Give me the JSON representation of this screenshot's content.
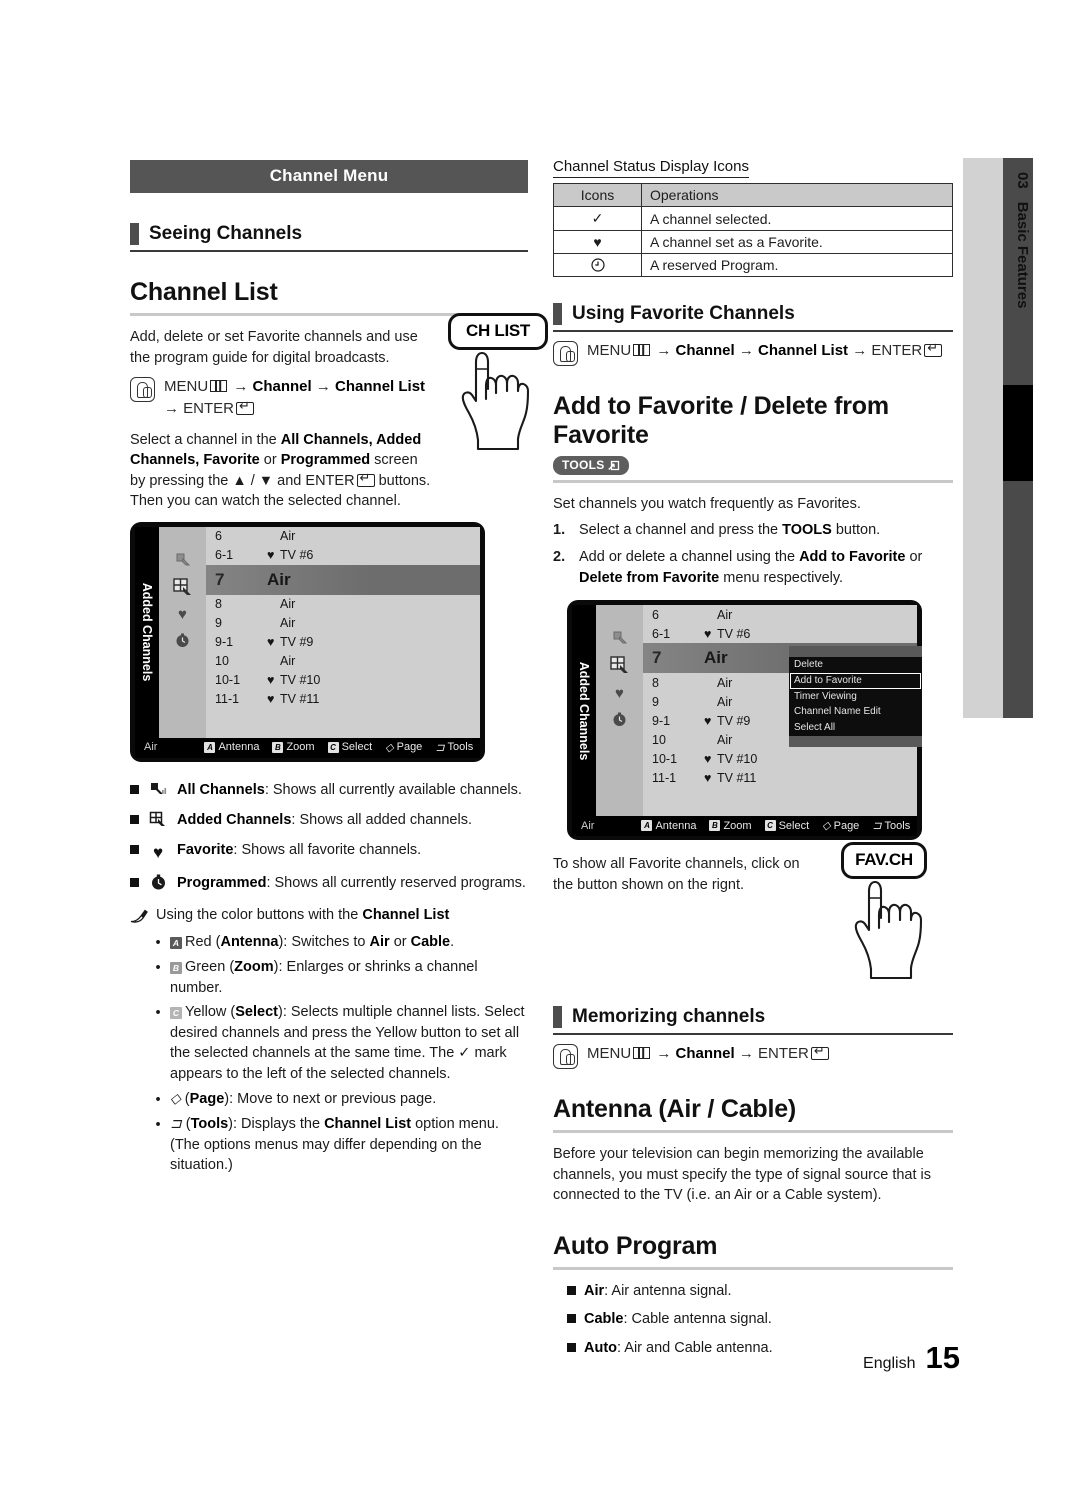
{
  "sidebar": {
    "chapter_number": "03",
    "chapter_title": "Basic Features"
  },
  "footer": {
    "language": "English",
    "page": "15"
  },
  "left": {
    "menu_bar": "Channel Menu",
    "section_heading": "Seeing Channels",
    "title": "Channel List",
    "intro": "Add, delete or set Favorite channels and use the program guide for digital broadcasts.",
    "menu_path": "MENU → Channel → Channel List → ENTER",
    "remote_button": "CH LIST",
    "select_text_1": "Select a channel in the ",
    "select_bold_1": "All Channels, Added Channels, Favorite",
    "select_text_2": " or ",
    "select_bold_2": "Programmed",
    "select_text_3": " screen by pressing the ▲ / ▼ and ENTER",
    "select_text_4": " buttons. Then you can watch the selected channel.",
    "tv": {
      "side_label": "Added Channels",
      "icons": [
        "all-channels-icon",
        "added-channels-icon",
        "favorite-icon",
        "programmed-icon"
      ],
      "rows": [
        {
          "num": "6",
          "fav": "",
          "name": "Air"
        },
        {
          "num": "6-1",
          "fav": "♥",
          "name": "TV #6"
        },
        {
          "num": "7",
          "fav": "",
          "name": "Air",
          "selected": true
        },
        {
          "num": "8",
          "fav": "",
          "name": "Air"
        },
        {
          "num": "9",
          "fav": "",
          "name": "Air"
        },
        {
          "num": "9-1",
          "fav": "♥",
          "name": "TV #9"
        },
        {
          "num": "10",
          "fav": "",
          "name": "Air"
        },
        {
          "num": "10-1",
          "fav": "♥",
          "name": "TV #10"
        },
        {
          "num": "11-1",
          "fav": "♥",
          "name": "TV #11"
        }
      ],
      "bar": {
        "air": "Air",
        "buttons": [
          {
            "key": "A",
            "label": "Antenna"
          },
          {
            "key": "B",
            "label": "Zoom"
          },
          {
            "key": "C",
            "label": "Select"
          },
          {
            "key": "◇",
            "label": "Page"
          },
          {
            "key": "⊐",
            "label": "Tools"
          }
        ]
      }
    },
    "bullets": [
      {
        "icon": "all-channels-icon",
        "bold": "All Channels",
        "text": ": Shows all currently available channels."
      },
      {
        "icon": "added-channels-icon",
        "bold": "Added Channels",
        "text": ": Shows all added channels."
      },
      {
        "icon": "favorite-icon",
        "bold": "Favorite",
        "text": ": Shows all favorite channels."
      },
      {
        "icon": "programmed-icon",
        "bold": "Programmed",
        "text": ": Shows all currently reserved programs."
      }
    ],
    "note_lead": "Using the color buttons with the ",
    "note_bold": "Channel List",
    "color_buttons": [
      {
        "key": "A",
        "color": "red",
        "pre": "Red (",
        "bold": "Antenna",
        "post": "): Switches to ",
        "bold2": "Air",
        "mid": " or ",
        "bold3": "Cable",
        "end": "."
      },
      {
        "key": "B",
        "color": "green",
        "pre": "Green (",
        "bold": "Zoom",
        "post": "): Enlarges or shrinks a channel number.",
        "bold2": "",
        "mid": "",
        "bold3": "",
        "end": ""
      },
      {
        "key": "C",
        "color": "yellow",
        "pre": "Yellow (",
        "bold": "Select",
        "post": "): Selects multiple channel lists. Select desired channels and press the Yellow button to set all the selected channels at the same time. The ✓ mark appears to the left of the selected channels.",
        "bold2": "",
        "mid": "",
        "bold3": "",
        "end": ""
      },
      {
        "key": "◇",
        "color": "none",
        "pre": "(",
        "bold": "Page",
        "post": "): Move to next or previous page.",
        "bold2": "",
        "mid": "",
        "bold3": "",
        "end": ""
      },
      {
        "key": "⊐",
        "color": "none",
        "pre": "(",
        "bold": "Tools",
        "post": "): Displays the ",
        "bold2": "Channel List",
        "mid": " option menu. (The options menus may differ depending on the situation.)",
        "bold3": "",
        "end": ""
      }
    ]
  },
  "right": {
    "status_title": "Channel Status Display Icons",
    "status_table": {
      "headers": [
        "Icons",
        "Operations"
      ],
      "rows": [
        {
          "icon": "✓",
          "icon_name": "check-icon",
          "op": "A channel selected."
        },
        {
          "icon": "♥",
          "icon_name": "heart-icon",
          "op": "A channel set as a Favorite."
        },
        {
          "icon": "◔",
          "icon_name": "clock-icon",
          "op": "A reserved Program."
        }
      ]
    },
    "fav_section_heading": "Using Favorite Channels",
    "fav_menu_path": "MENU → Channel → Channel List → ENTER",
    "add_title": "Add to Favorite / Delete from Favorite",
    "tools_badge": "TOOLS",
    "add_intro": "Set channels you watch frequently as Favorites.",
    "steps": [
      {
        "n": "1.",
        "pre": "Select a channel and press the ",
        "bold": "TOOLS",
        "post": " button."
      },
      {
        "n": "2.",
        "pre": "Add or delete a channel using the ",
        "bold": "Add to Favorite",
        "post": " or ",
        "bold2": "Delete from Favorite",
        "post2": " menu respectively."
      }
    ],
    "tv": {
      "side_label": "Added Channels",
      "rows": [
        {
          "num": "6",
          "fav": "",
          "name": "Air"
        },
        {
          "num": "6-1",
          "fav": "♥",
          "name": "TV #6"
        },
        {
          "num": "7",
          "fav": "",
          "name": "Air",
          "selected": true
        },
        {
          "num": "8",
          "fav": "",
          "name": "Air"
        },
        {
          "num": "9",
          "fav": "",
          "name": "Air"
        },
        {
          "num": "9-1",
          "fav": "♥",
          "name": "TV #9"
        },
        {
          "num": "10",
          "fav": "",
          "name": "Air"
        },
        {
          "num": "10-1",
          "fav": "♥",
          "name": "TV #10"
        },
        {
          "num": "11-1",
          "fav": "♥",
          "name": "TV #11"
        }
      ],
      "context_menu": [
        "Delete",
        "Add to Favorite",
        "Timer Viewing",
        "Channel Name Edit",
        "Select All"
      ],
      "context_menu_selected": "Add to Favorite",
      "bar": {
        "air": "Air",
        "buttons": [
          {
            "key": "A",
            "label": "Antenna"
          },
          {
            "key": "B",
            "label": "Zoom"
          },
          {
            "key": "C",
            "label": "Select"
          },
          {
            "key": "◇",
            "label": "Page"
          },
          {
            "key": "⊐",
            "label": "Tools"
          }
        ]
      }
    },
    "fav_note": "To show all Favorite channels, click on the button shown on the rignt.",
    "fav_button": "FAV.CH",
    "memorizing_heading": "Memorizing channels",
    "memorizing_path": "MENU → Channel → ENTER",
    "antenna_title": "Antenna (Air / Cable)",
    "antenna_body": "Before your television can begin memorizing the available channels, you must specify the type of signal source that is connected to the TV (i.e. an Air or a Cable system).",
    "auto_title": "Auto Program",
    "auto_items": [
      {
        "bold": "Air",
        "text": ": Air antenna signal."
      },
      {
        "bold": "Cable",
        "text": ": Cable antenna signal."
      },
      {
        "bold": "Auto",
        "text": ": Air and Cable antenna."
      }
    ]
  }
}
